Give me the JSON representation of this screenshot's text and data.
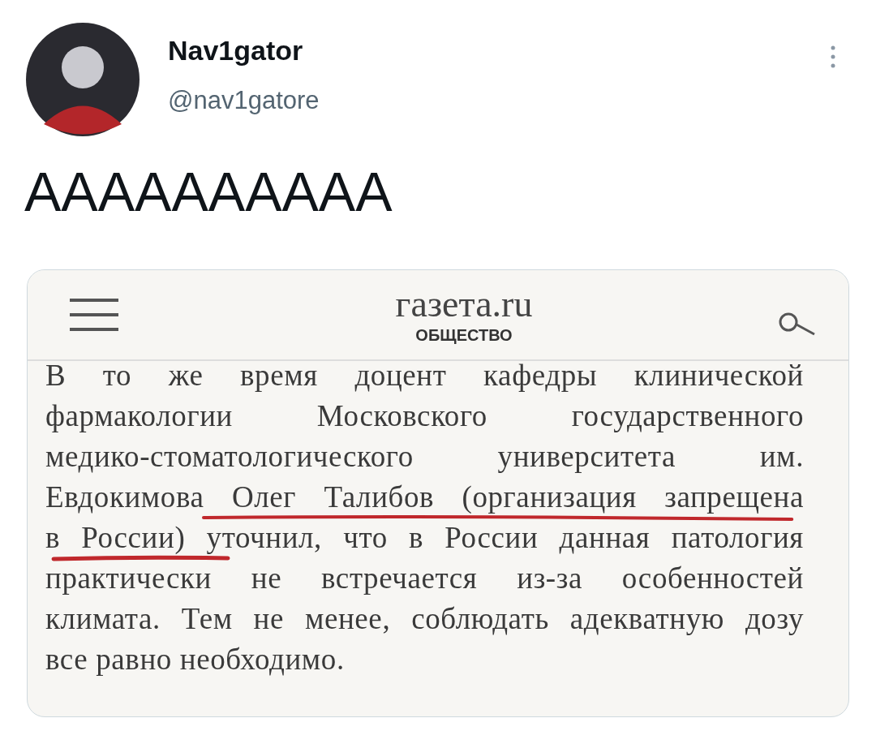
{
  "author": {
    "name": "Nav1gator",
    "handle": "@nav1gatore"
  },
  "tweet_text": "АААААААААА",
  "embedded_image": {
    "site_title": "газета.ru",
    "section": "ОБЩЕСТВО",
    "article_lines": [
      "В то же время доцент кафедры клинической",
      "фармакологии Московского государственного",
      "медико-стоматологического университета им.",
      "Евдокимова Олег Талибов (организация запрещена",
      "в России) уточнил, что в России данная патология",
      "практически не встречается из-за особенностей",
      "климата. Тем не менее, соблюдать адекватную дозу",
      "все равно необходимо."
    ]
  }
}
